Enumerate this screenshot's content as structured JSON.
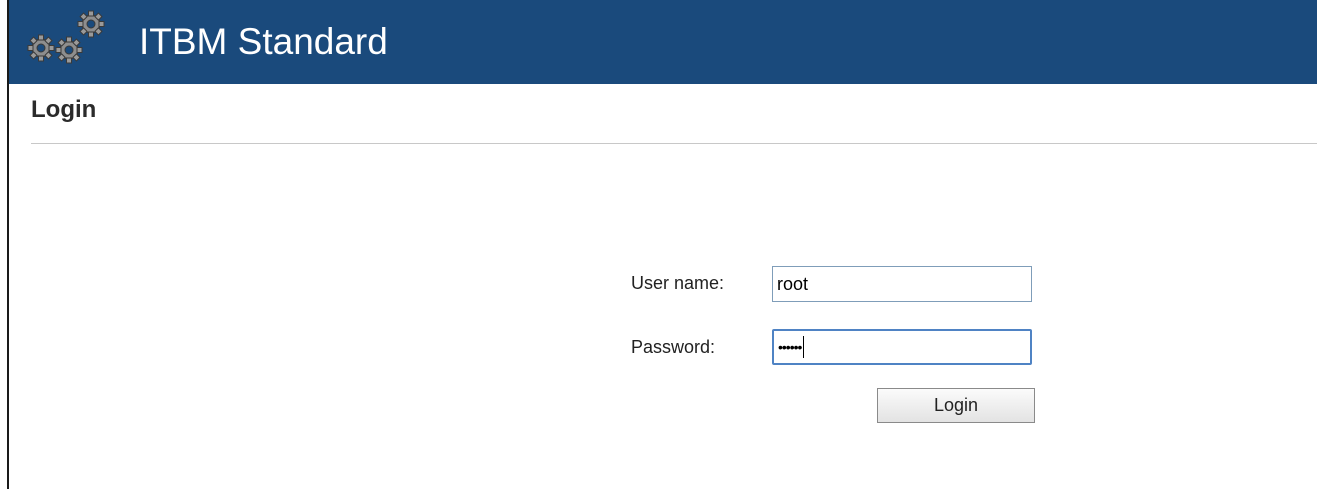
{
  "header": {
    "app_title": "ITBM Standard",
    "logo_icon": "gears-icon",
    "background_color": "#1a4a7c"
  },
  "page": {
    "title": "Login"
  },
  "form": {
    "username_label": "User name:",
    "username_value": "root",
    "password_label": "Password:",
    "password_masked": "••••••",
    "login_button_label": "Login"
  }
}
